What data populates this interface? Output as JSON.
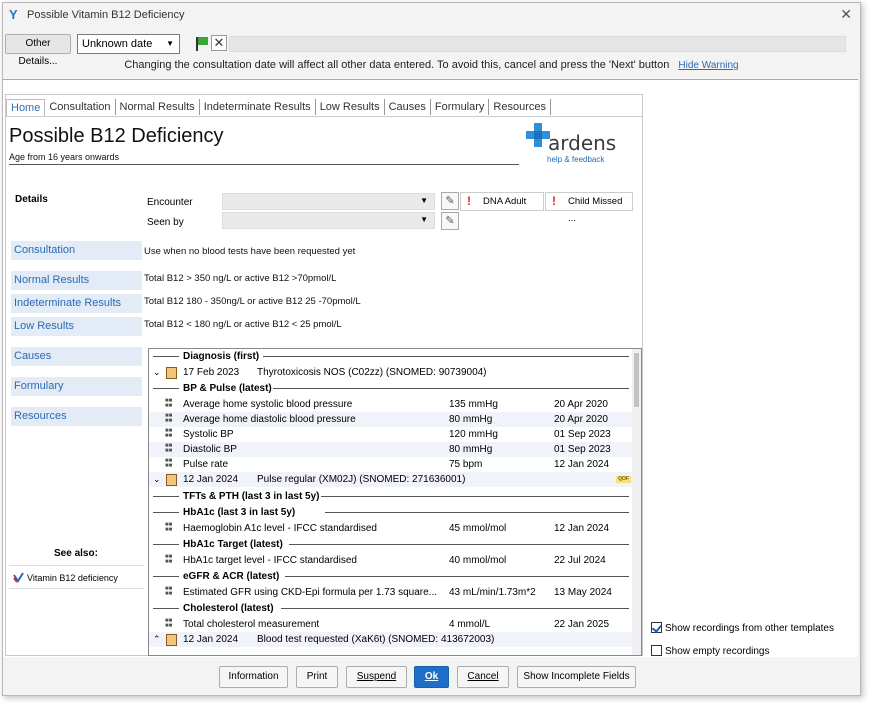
{
  "window": {
    "title": "Possible Vitamin B12 Deficiency"
  },
  "toolbar": {
    "other_details": "Other Details...",
    "date_value": "Unknown date",
    "warning": "Changing the consultation date will affect all other data entered. To avoid this, cancel and press the 'Next' button",
    "hide_warning": "Hide Warning"
  },
  "tabs": [
    "Home",
    "Consultation",
    "Normal Results",
    "Indeterminate Results",
    "Low Results",
    "Causes",
    "Formulary",
    "Resources"
  ],
  "page": {
    "title": "Possible B12 Deficiency",
    "subtitle": "Age from 16 years onwards",
    "logo_text": "ardens",
    "logo_help": "help & feedback"
  },
  "details": {
    "label": "Details",
    "encounter_label": "Encounter",
    "seen_by_label": "Seen by",
    "dna_adult": "DNA Adult",
    "child_missed": "Child Missed ..."
  },
  "nav": [
    {
      "label": "Consultation",
      "desc": "Use when no blood tests have been requested yet"
    },
    {
      "label": "Normal Results",
      "desc": "Total B12 > 350 ng/L or active B12 >70pmol/L"
    },
    {
      "label": "Indeterminate Results",
      "desc": "Total B12 180 - 350ng/L or active B12 25 -70pmol/L"
    },
    {
      "label": "Low Results",
      "desc": "Total B12 < 180 ng/L or active B12 < 25 pmol/L"
    },
    {
      "label": "Causes",
      "desc": ""
    },
    {
      "label": "Formulary",
      "desc": ""
    },
    {
      "label": "Resources",
      "desc": ""
    }
  ],
  "see_also": {
    "label": "See also:",
    "item": "Vitamin B12 deficiency"
  },
  "records": {
    "diag_header": "Diagnosis (first)",
    "diag_date": "17 Feb 2023",
    "diag_text": "Thyrotoxicosis NOS (C02zz) (SNOMED: 90739004)",
    "bp_header": "BP & Pulse (latest)",
    "bp_rows": [
      {
        "name": "Average home systolic blood pressure",
        "value": "135 mmHg",
        "date": "20 Apr 2020"
      },
      {
        "name": "Average home diastolic blood pressure",
        "value": "80 mmHg",
        "date": "20 Apr 2020"
      },
      {
        "name": "Systolic BP",
        "value": "120 mmHg",
        "date": "01 Sep 2023"
      },
      {
        "name": "Diastolic BP",
        "value": "80 mmHg",
        "date": "01 Sep 2023"
      },
      {
        "name": "Pulse rate",
        "value": "75 bpm",
        "date": "12 Jan 2024"
      }
    ],
    "pulse_date": "12 Jan 2024",
    "pulse_text": "Pulse regular (XM02J) (SNOMED: 271636001)",
    "qof": "QOF",
    "tft_header": "TFTs & PTH (last 3 in last 5y)",
    "hba_header": "HbA1c (last 3 in last 5y)",
    "hba_row": {
      "name": "Haemoglobin A1c level - IFCC standardised",
      "value": "45 mmol/mol",
      "date": "12 Jan 2024"
    },
    "hbt_header": "HbA1c Target (latest)",
    "hbt_row": {
      "name": "HbA1c target level - IFCC standardised",
      "value": "40 mmol/mol",
      "date": "22 Jul 2024"
    },
    "egfr_header": "eGFR & ACR (latest)",
    "egfr_row": {
      "name": "Estimated GFR using CKD-Epi formula per 1.73 square...",
      "value": "43 mL/min/1.73m*2",
      "date": "13 May 2024"
    },
    "chol_header": "Cholesterol (latest)",
    "chol_row": {
      "name": "Total cholesterol measurement",
      "value": "4 mmol/L",
      "date": "22 Jan 2025"
    },
    "blood_date": "12 Jan 2024",
    "blood_text": "Blood test requested (XaK6t) (SNOMED: 413672003)"
  },
  "options": {
    "show_other": "Show recordings from other templates",
    "show_empty": "Show empty recordings"
  },
  "footer": {
    "information": "Information",
    "print": "Print",
    "suspend": "Suspend",
    "ok": "Ok",
    "cancel": "Cancel",
    "show_incomplete": "Show Incomplete Fields"
  }
}
